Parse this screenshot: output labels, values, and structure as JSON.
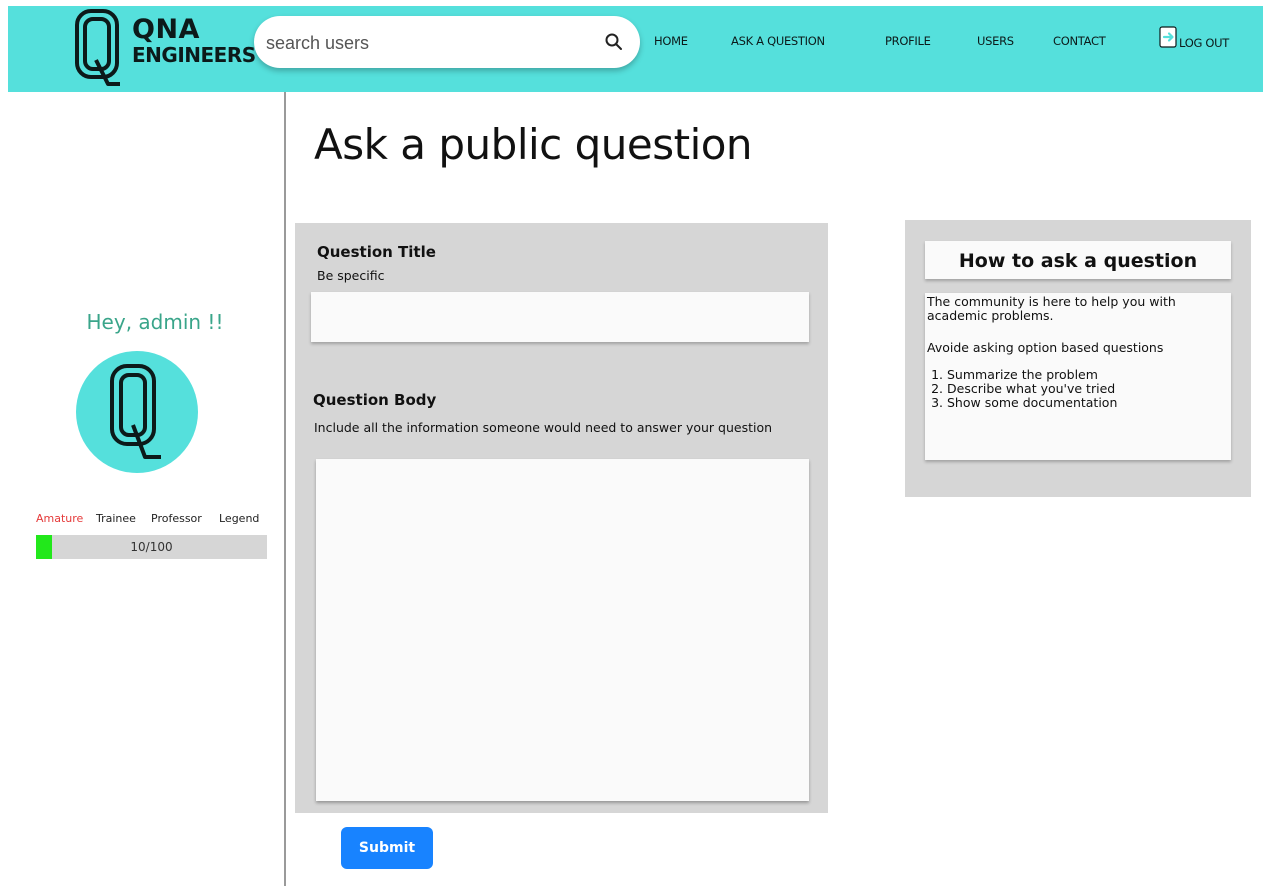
{
  "header": {
    "logo_line1": "QNA",
    "logo_line2": "ENGINEERS",
    "search_placeholder": "search users",
    "nav": {
      "home": "HOME",
      "ask": "ASK A QUESTION",
      "profile": "PROFILE",
      "users": "USERS",
      "contact": "CONTACT",
      "logout": "LOG OUT"
    },
    "icons": {
      "search": "search-icon",
      "logout": "logout-icon"
    }
  },
  "sidebar": {
    "greeting": "Hey, admin !!",
    "ranks": [
      "Amature",
      "Trainee",
      "Professor",
      "Legend"
    ],
    "active_rank": "Amature",
    "progress_text": "10/100",
    "progress_value": 10,
    "progress_max": 100
  },
  "main": {
    "page_title": "Ask a public question",
    "question_title_label": "Question Title",
    "question_title_hint": "Be specific",
    "question_body_label": "Question Body",
    "question_body_hint": "Include all the information someone would need to answer your question",
    "submit_label": "Submit"
  },
  "help": {
    "title": "How to ask a question",
    "p1": "The community is here to help you with academic problems.",
    "p2": "Avoide asking option based questions",
    "steps": [
      "Summarize the problem",
      "Describe what you've tried",
      "Show some documentation"
    ]
  },
  "colors": {
    "header_bg": "#55e0dc",
    "greeting": "#3aa58a",
    "active_rank": "#e53a3a",
    "progress_fill": "#22e81b",
    "submit_bg": "#1883ff",
    "panel_bg": "#d6d6d6"
  }
}
